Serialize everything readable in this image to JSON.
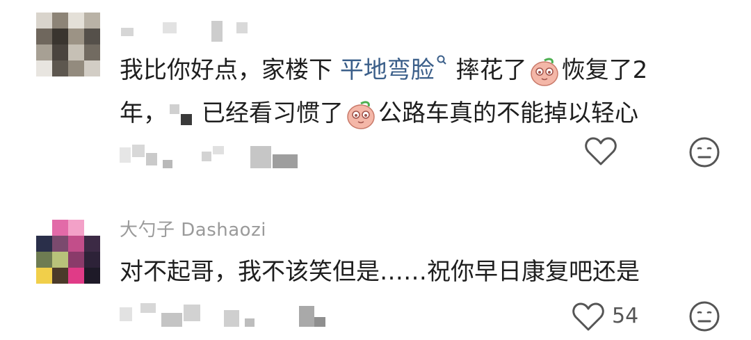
{
  "comments": [
    {
      "username": "",
      "text_part1": "我比你好点，家楼下 ",
      "link_text": "平地弯脸",
      "text_part2": " 摔花了",
      "text_part3": "恢复了2",
      "line2_start": "年，",
      "line2_mid": "已经看习惯了",
      "line2_end": "公路车真的不能掉以轻心",
      "like_count": "",
      "icons": [
        "link-search-icon",
        "peach-emoji-icon",
        "heart-icon",
        "neutral-face-icon"
      ]
    },
    {
      "username": "大勺子 Dashaozi",
      "text": "对不起哥，我不该笑但是……祝你早日康复吧还是",
      "like_count": "54",
      "icons": [
        "heart-icon",
        "neutral-face-icon"
      ]
    }
  ],
  "colors": {
    "link": "#3b5f8a",
    "text": "#1e1e1e",
    "muted": "#9a9a9a"
  }
}
